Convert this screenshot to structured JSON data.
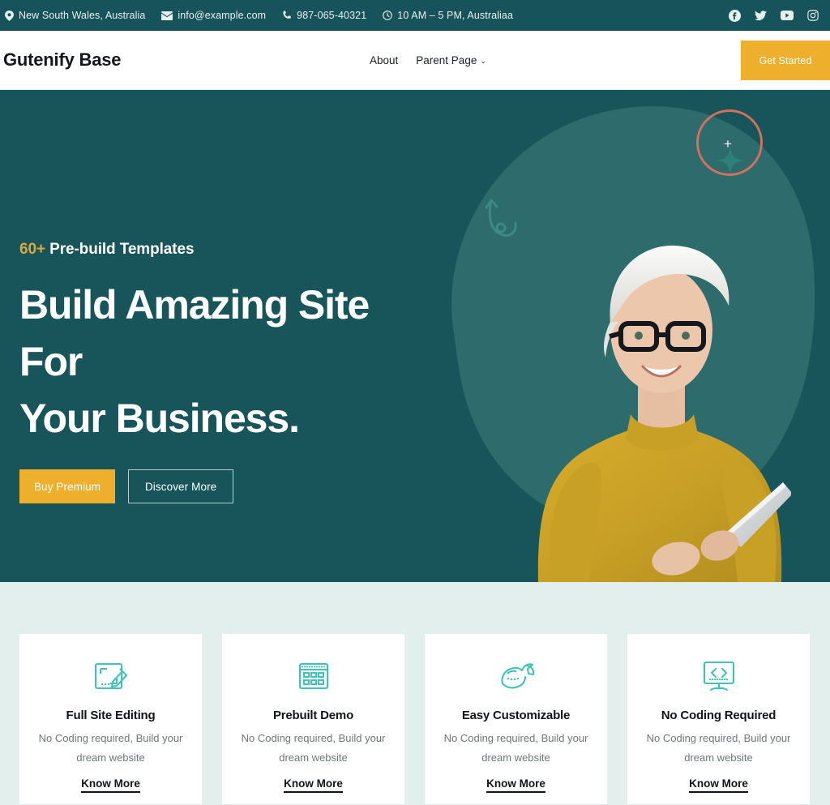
{
  "topbar": {
    "items": [
      {
        "icon": "location-pin-icon",
        "text": "New South Wales, Australia"
      },
      {
        "icon": "envelope-icon",
        "text": "info@example.com"
      },
      {
        "icon": "phone-icon",
        "text": "987-065-40321"
      },
      {
        "icon": "clock-icon",
        "text": "10 AM – 5 PM, Australiaa"
      }
    ],
    "social": [
      {
        "icon": "facebook-icon",
        "name": "Facebook"
      },
      {
        "icon": "twitter-icon",
        "name": "Twitter"
      },
      {
        "icon": "youtube-icon",
        "name": "YouTube"
      },
      {
        "icon": "instagram-icon",
        "name": "Instagram"
      }
    ],
    "background_color": "#17535a"
  },
  "header": {
    "logo": "Gutenify Base",
    "nav": [
      {
        "label": "About",
        "has_submenu": false
      },
      {
        "label": "Parent Page",
        "has_submenu": true
      }
    ],
    "caret": "⌄",
    "cta_label": "Get Started",
    "cta_color": "#eeaf2c"
  },
  "hero": {
    "eyebrow_number": "60",
    "eyebrow_plus": "+",
    "eyebrow_text": "Pre-build Templates",
    "title_line_1": "Build Amazing Site For",
    "title_line_2": "Your Business.",
    "primary_button": "Buy Premium",
    "secondary_button": "Discover More",
    "background_color": "#17555a",
    "blob_color": "#2b6a6c",
    "accent_color": "#eeaf2c",
    "circle_color": "#d2705c",
    "plus_glyph": "+",
    "image_alt": "Smiling woman with short white hair, glasses and a mustard turtleneck holding a tablet"
  },
  "features": {
    "background_color": "#e2efed",
    "cards": [
      {
        "icon": "edit-frame-icon",
        "title": "Full Site Editing",
        "description": "No Coding required, Build your dream website",
        "link": "Know More"
      },
      {
        "icon": "window-grid-icon",
        "title": "Prebuilt Demo",
        "description": "No Coding required, Build your dream website",
        "link": "Know More"
      },
      {
        "icon": "hand-wrench-icon",
        "title": "Easy Customizable",
        "description": "No Coding required, Build your dream website",
        "link": "Know More"
      },
      {
        "icon": "monitor-code-icon",
        "title": "No Coding Required",
        "description": "No Coding required, Build your dream website",
        "link": "Know More"
      }
    ],
    "icon_color": "#3fc3b8"
  }
}
